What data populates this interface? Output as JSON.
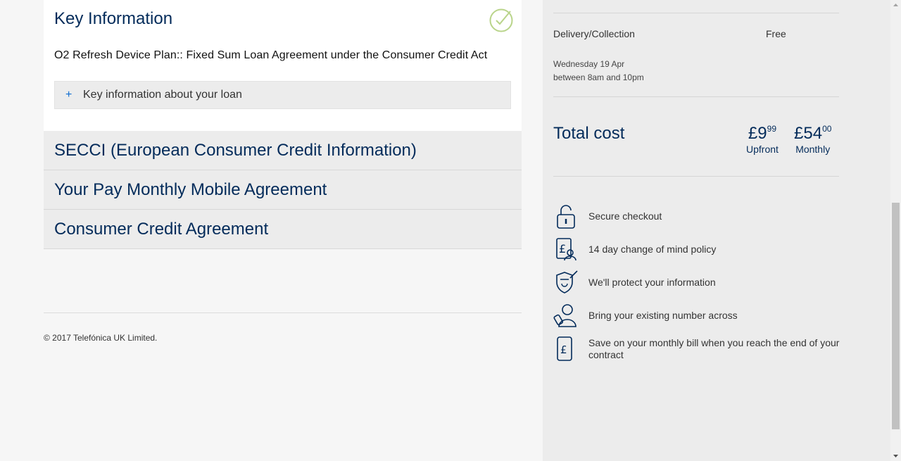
{
  "key_info": {
    "title": "Key Information",
    "subtitle": "O2 Refresh Device Plan:: Fixed Sum Loan Agreement under the Consumer Credit Act",
    "loan_toggle": "+",
    "loan_label": "Key information about your loan"
  },
  "accordions": [
    {
      "label": "SECCI (European Consumer Credit Information)"
    },
    {
      "label": "Your Pay Monthly Mobile Agreement"
    },
    {
      "label": "Consumer Credit Agreement"
    }
  ],
  "footer": {
    "copyright": "© 2017 Telefónica UK Limited."
  },
  "summary": {
    "delivery_label": "Delivery/Collection",
    "delivery_price": "Free",
    "delivery_date_line1": "Wednesday 19 Apr",
    "delivery_date_line2": "between 8am and 10pm",
    "total_label": "Total cost",
    "upfront": {
      "currency": "£",
      "whole": "9",
      "pence": "99",
      "caption": "Upfront"
    },
    "monthly": {
      "currency": "£",
      "whole": "54",
      "pence": "00",
      "caption": "Monthly"
    }
  },
  "features": [
    {
      "icon": "padlock-icon",
      "text": "Secure checkout"
    },
    {
      "icon": "pound-person-icon",
      "text": "14 day change of mind policy"
    },
    {
      "icon": "shield-check-icon",
      "text": "We'll protect your information"
    },
    {
      "icon": "person-phone-icon",
      "text": "Bring your existing number across"
    },
    {
      "icon": "pound-phone-icon",
      "text": "Save on your monthly bill when you reach the end of your contract"
    }
  ],
  "colors": {
    "brand": "#032b5a",
    "accent": "#0d6ad1",
    "check": "#b9d48a"
  }
}
